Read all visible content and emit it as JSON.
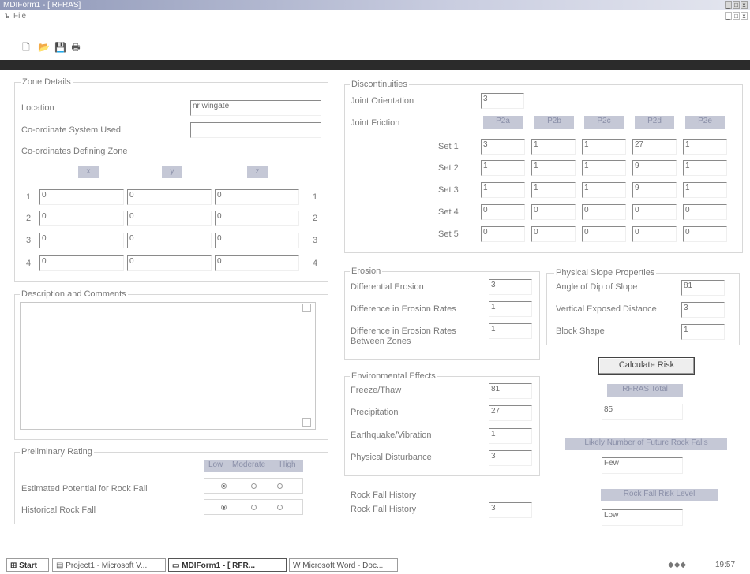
{
  "window": {
    "title": "MDIForm1 - [ RFRAS]",
    "min": "_",
    "max": "□",
    "close": "x"
  },
  "menu": {
    "file": "File"
  },
  "toolbar": {
    "new": "🗋",
    "open": "📂",
    "save": "💾",
    "print": "🖶"
  },
  "zone": {
    "legend": "Zone Details",
    "location_label": "Location",
    "location_value": "nr wingate",
    "coord_system_label": "Co-ordinate System Used",
    "coord_system_value": "",
    "coords_label": "Co-ordinates Defining Zone",
    "headers": [
      "x",
      "y",
      "z"
    ],
    "rows": [
      {
        "n": "1",
        "x": "0",
        "y": "0",
        "z": "0"
      },
      {
        "n": "2",
        "x": "0",
        "y": "0",
        "z": "0"
      },
      {
        "n": "3",
        "x": "0",
        "y": "0",
        "z": "0"
      },
      {
        "n": "4",
        "x": "0",
        "y": "0",
        "z": "0"
      }
    ]
  },
  "description": {
    "legend": "Description and Comments",
    "value": ""
  },
  "preliminary": {
    "legend": "Preliminary Rating",
    "levels": [
      "Low",
      "Moderate",
      "High"
    ],
    "potential_label": "Estimated Potential for Rock Fall",
    "potential_selected": "Low",
    "historical_label": "Historical Rock Fall",
    "historical_selected": "Low"
  },
  "discontinuities": {
    "legend": "Discontinuities",
    "orientation_label": "Joint Orientation",
    "orientation_value": "3",
    "friction_label": "Joint Friction",
    "columns": [
      "P2a",
      "P2b",
      "P2c",
      "P2d",
      "P2e"
    ],
    "sets": [
      {
        "label": "Set 1",
        "values": [
          "3",
          "1",
          "1",
          "27",
          "1"
        ]
      },
      {
        "label": "Set 2",
        "values": [
          "1",
          "1",
          "1",
          "9",
          "1"
        ]
      },
      {
        "label": "Set 3",
        "values": [
          "1",
          "1",
          "1",
          "9",
          "1"
        ]
      },
      {
        "label": "Set 4",
        "values": [
          "0",
          "0",
          "0",
          "0",
          "0"
        ]
      },
      {
        "label": "Set 5",
        "values": [
          "0",
          "0",
          "0",
          "0",
          "0"
        ]
      }
    ]
  },
  "erosion": {
    "legend": "Erosion",
    "differential_label": "Differential Erosion",
    "differential_value": "3",
    "difference_label": "Difference in Erosion Rates",
    "difference_value": "1",
    "between_label": "Difference in Erosion Rates Between Zones",
    "between_value": "1"
  },
  "slope": {
    "legend": "Physical Slope Properties",
    "dip_label": "Angle of Dip of Slope",
    "dip_value": "81",
    "vertical_label": "Vertical Exposed Distance",
    "vertical_value": "3",
    "block_label": "Block Shape",
    "block_value": "1"
  },
  "environment": {
    "legend": "Environmental Effects",
    "freeze_label": "Freeze/Thaw",
    "freeze_value": "81",
    "precip_label": "Precipitation",
    "precip_value": "27",
    "quake_label": "Earthquake/Vibration",
    "quake_value": "1",
    "disturb_label": "Physical Disturbance",
    "disturb_value": "3"
  },
  "history": {
    "legend": "Rock Fall History",
    "label": "Rock Fall History",
    "value": "3"
  },
  "results": {
    "calc_button": "Calculate Risk",
    "total_label": "RFRAS Total",
    "total_value": "85",
    "likely_label": "Likely Number of Future Rock Falls",
    "likely_value": "Few",
    "risk_label": "Rock Fall Risk Level",
    "risk_value": "Low"
  },
  "taskbar": {
    "start": "Start",
    "tasks": [
      "Project1 - Microsoft V...",
      "MDIForm1 - [ RFR...",
      "Microsoft Word - Doc..."
    ],
    "clock": "19:57"
  }
}
